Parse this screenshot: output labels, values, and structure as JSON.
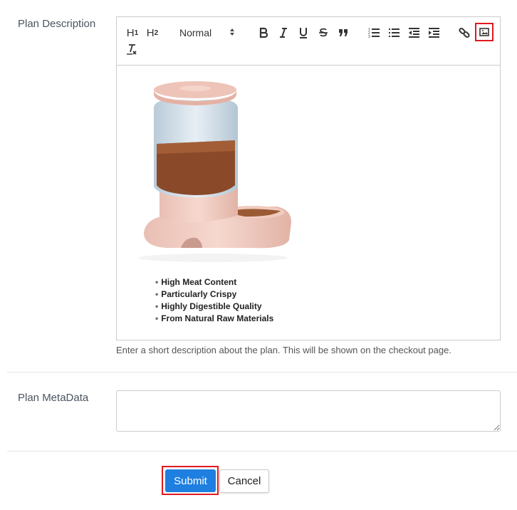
{
  "description_field": {
    "label": "Plan Description",
    "toolbar": {
      "h1": "H",
      "h1_sub": "1",
      "h2": "H",
      "h2_sub": "2",
      "format_select": "Normal",
      "icons": [
        "bold-icon",
        "italic-icon",
        "underline-icon",
        "strikethrough-icon",
        "blockquote-icon",
        "ordered-list-icon",
        "bullet-list-icon",
        "outdent-icon",
        "indent-icon",
        "link-icon",
        "image-icon",
        "clear-format-icon"
      ],
      "highlight_color": "#e0191f"
    },
    "content": {
      "image_alt": "Automatic pet food dispenser",
      "features": [
        "High Meat Content",
        "Particularly Crispy",
        "Highly Digestible Quality",
        "From Natural Raw Materials"
      ]
    },
    "help_text": "Enter a short description about the plan. This will be shown on the checkout page."
  },
  "metadata_field": {
    "label": "Plan MetaData",
    "value": ""
  },
  "actions": {
    "submit_label": "Submit",
    "cancel_label": "Cancel",
    "submit_color": "#1e7fe0"
  }
}
